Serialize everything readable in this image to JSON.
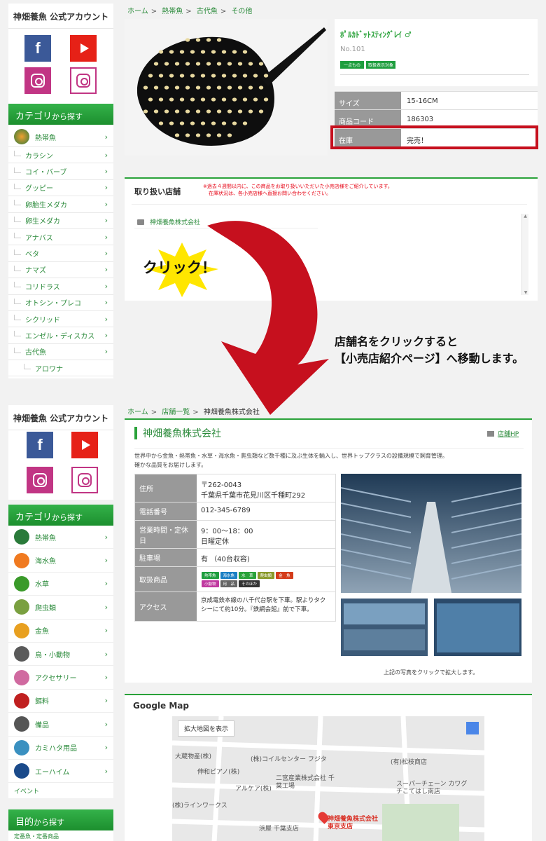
{
  "sidebar": {
    "account_title": "神畑養魚 公式アカウント",
    "category_title": "カテゴリ",
    "category_title_suffix": "から探す",
    "top_categories": [
      "熱帯魚",
      "カラシン",
      "コイ・バーブ",
      "グッピー",
      "卵胎生メダカ",
      "卵生メダカ",
      "アナバス",
      "ベタ",
      "ナマズ",
      "コリドラス",
      "オトシン・プレコ",
      "シクリッド",
      "エンゼル・ディスカス",
      "古代魚",
      "アロワナ"
    ],
    "bottom_categories": [
      "熱帯魚",
      "海水魚",
      "水草",
      "爬虫類",
      "金魚",
      "鳥・小動物",
      "アクセサリー",
      "餌料",
      "備品",
      "カミハタ用品",
      "エーハイム"
    ],
    "event_label": "イベント",
    "purpose_title": "目的",
    "purpose_suffix": "から探す",
    "purpose_first": "定番魚・定番商品"
  },
  "product_page": {
    "breadcrumb": [
      "ホーム",
      "熱帯魚",
      "古代魚",
      "その他"
    ],
    "name": "ﾎﾟﾙｶﾄﾞｯﾄｽﾃｨﾝｸﾞﾚｲ ♂",
    "number": "No.101",
    "badges": [
      "一点もの",
      "取扱表示対象"
    ],
    "specs": [
      {
        "key": "サイズ",
        "value": "15-16CM"
      },
      {
        "key": "商品コード",
        "value": "186303"
      },
      {
        "key": "在庫",
        "value": "完売！"
      }
    ],
    "store_section_title": "取り扱い店舗",
    "store_notice_1": "※過去４週間以内に、この商品をお取り扱いいただいた小売店様をご紹介しています。",
    "store_notice_2": "在庫状況は、各小売店様へ直接お問い合わせください。",
    "store_name": "神畑養魚株式会社"
  },
  "annotation": {
    "click_label": "クリック！",
    "message_line1": "店舗名をクリックすると",
    "message_line2": "【小売店紹介ページ】へ移動します。"
  },
  "shop_page": {
    "breadcrumb_home": "ホーム",
    "breadcrumb_list": "店舗一覧",
    "breadcrumb_current": "神畑養魚株式会社",
    "title": "神畑養魚株式会社",
    "hp_link": "店舗HP",
    "description_1": "世界中から金魚・熱帯魚・水草・海水魚・爬虫類など数千種に及ぶ生体を輸入し、世界トップクラスの設備規模で飼育管理。",
    "description_2": "確かな品質をお届けします。",
    "info": [
      {
        "key": "住所",
        "value": "〒262-0043\n千葉県千葉市花見川区千種町292"
      },
      {
        "key": "電話番号",
        "value": "012-345-6789"
      },
      {
        "key": "営業時間・定休日",
        "value": "9：00～18：00\n日曜定休"
      },
      {
        "key": "駐車場",
        "value": "有 （40台収容)"
      },
      {
        "key": "取扱商品",
        "value": ""
      },
      {
        "key": "アクセス",
        "value": "京成電鉄本線の八千代台駅を下車。駅よりタクシーにて約10分。『鉄網会館』前で下車。"
      }
    ],
    "product_tags": [
      {
        "label": "熱帯魚",
        "color": "#1e9e3e"
      },
      {
        "label": "海水魚",
        "color": "#1a7fc4"
      },
      {
        "label": "水　草",
        "color": "#2aa23a"
      },
      {
        "label": "爬虫類",
        "color": "#8a9a2a"
      },
      {
        "label": "金　魚",
        "color": "#d43c1a"
      },
      {
        "label": "小動物",
        "color": "#c03aa0"
      },
      {
        "label": "用　品",
        "color": "#666666"
      },
      {
        "label": "そのほか",
        "color": "#333333"
      }
    ],
    "photo_caption": "上記の写真をクリックで拡大します。",
    "map_title": "Google Map",
    "map_enlarge": "拡大地図を表示",
    "map_labels": [
      "大蔵物産(株)",
      "(株)コイルセンター フジタ",
      "(有)松枝商店",
      "伸和ピアノ(株)",
      "二宮産業株式会社 千葉工場",
      "アルケア(株)",
      "スーパーチェーン カワグチこてはし南店",
      "(株)ラインワークス",
      "浜屋 千葉支店",
      "神畑養魚株式会社 東京支店"
    ]
  },
  "colors": {
    "accent": "#2aa23a",
    "arrow": "#c6101e",
    "highlight": "#c6101e"
  }
}
